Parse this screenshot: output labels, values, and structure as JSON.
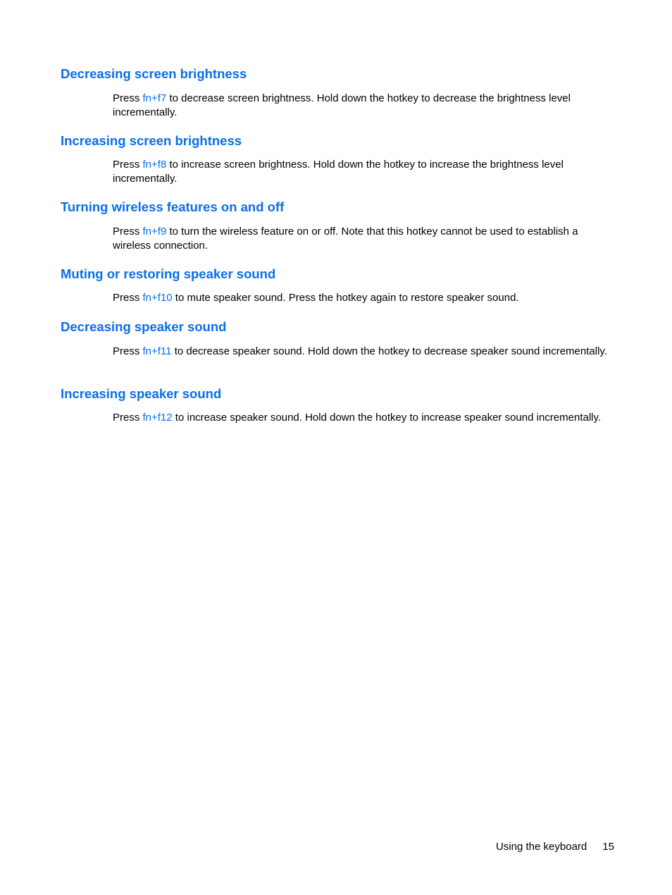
{
  "accent_color": "#0a6ee8",
  "sections": [
    {
      "heading": "Decreasing screen brightness",
      "pre": "Press ",
      "key": "fn+f7",
      "post": " to decrease screen brightness. Hold down the hotkey to decrease the brightness level incrementally."
    },
    {
      "heading": "Increasing screen brightness",
      "pre": "Press ",
      "key": "fn+f8",
      "post": " to increase screen brightness. Hold down the hotkey to increase the brightness level incrementally."
    },
    {
      "heading": "Turning wireless features on and off",
      "pre": "Press ",
      "key": "fn+f9",
      "post": " to turn the wireless feature on or off. Note that this hotkey cannot be used to establish a wireless connection."
    },
    {
      "heading": "Muting or restoring speaker sound",
      "pre": "Press ",
      "key": "fn+f10",
      "post": " to mute speaker sound. Press the hotkey again to restore speaker sound."
    },
    {
      "heading": "Decreasing speaker sound",
      "pre": "Press ",
      "key": "fn+f11",
      "post": " to decrease speaker sound. Hold down the hotkey to decrease speaker sound incrementally."
    },
    {
      "heading": "Increasing speaker sound",
      "pre": "Press ",
      "key": "fn+f12",
      "post": " to increase speaker sound. Hold down the hotkey to increase speaker sound incrementally."
    }
  ],
  "footer": {
    "chapter": "Using the keyboard",
    "page": "15"
  }
}
